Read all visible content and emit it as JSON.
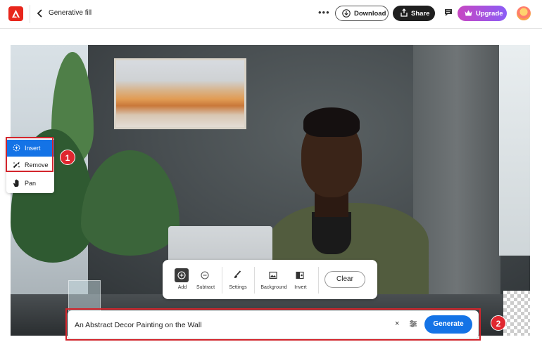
{
  "header": {
    "title": "Generative fill",
    "download_label": "Download",
    "share_label": "Share",
    "upgrade_label": "Upgrade",
    "more_label": "•••"
  },
  "tools": {
    "insert_label": "Insert",
    "remove_label": "Remove",
    "pan_label": "Pan"
  },
  "markers": {
    "one": "1",
    "two": "2"
  },
  "selection_toolbar": {
    "add_label": "Add",
    "subtract_label": "Subtract",
    "settings_label": "Settings",
    "background_label": "Background",
    "invert_label": "Invert",
    "clear_label": "Clear"
  },
  "prompt": {
    "text": "An Abstract Decor Painting on the Wall",
    "clear_glyph": "×",
    "generate_label": "Generate"
  },
  "colors": {
    "accent": "#1473e6",
    "highlight": "#d3252c",
    "brand": "#e8261c"
  }
}
